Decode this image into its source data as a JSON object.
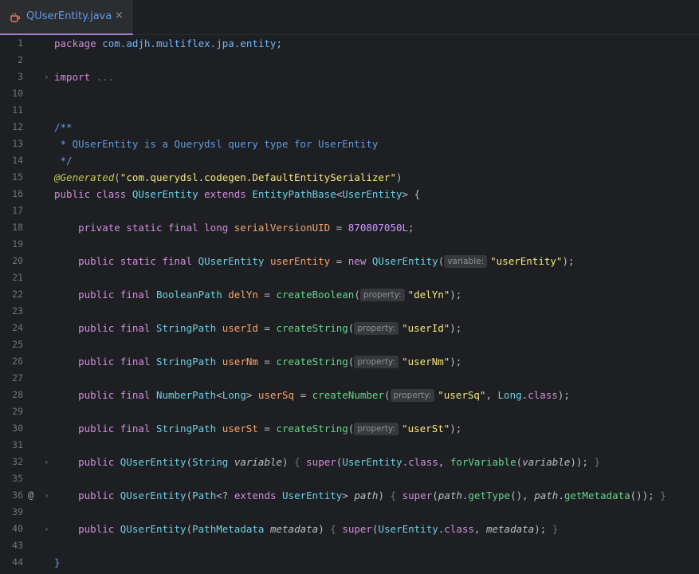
{
  "tab": {
    "filename": "QUserEntity.java",
    "close": "×"
  },
  "lines": [
    {
      "n": "1",
      "tokens": [
        [
          "kw",
          "package "
        ],
        [
          "pkg",
          "com.adjh.multiflex.jpa.entity"
        ],
        [
          "pun",
          ";"
        ]
      ]
    },
    {
      "n": "2",
      "tokens": []
    },
    {
      "n": "3",
      "fold": "›",
      "tokens": [
        [
          "kw",
          "import "
        ],
        [
          "dim",
          "..."
        ]
      ]
    },
    {
      "n": "10",
      "tokens": []
    },
    {
      "n": "11",
      "tokens": []
    },
    {
      "n": "12",
      "tokens": [
        [
          "cmt",
          "/**"
        ]
      ]
    },
    {
      "n": "13",
      "tokens": [
        [
          "cmt",
          " * QUserEntity is a Querydsl query type for UserEntity"
        ]
      ]
    },
    {
      "n": "14",
      "tokens": [
        [
          "cmt",
          " */"
        ]
      ]
    },
    {
      "n": "15",
      "tokens": [
        [
          "ann",
          "@Generated"
        ],
        [
          "pun",
          "("
        ],
        [
          "str",
          "\"com.querydsl.codegen.DefaultEntitySerializer\""
        ],
        [
          "pun",
          ")"
        ]
      ]
    },
    {
      "n": "16",
      "tokens": [
        [
          "kw",
          "public class "
        ],
        [
          "cls",
          "QUserEntity "
        ],
        [
          "kw",
          "extends "
        ],
        [
          "cls",
          "EntityPathBase"
        ],
        [
          "pun",
          "<"
        ],
        [
          "cls",
          "UserEntity"
        ],
        [
          "pun",
          "> {"
        ]
      ]
    },
    {
      "n": "17",
      "tokens": []
    },
    {
      "n": "18",
      "tokens": [
        [
          "pun",
          "    "
        ],
        [
          "kw",
          "private static final long "
        ],
        [
          "fld",
          "serialVersionUID"
        ],
        [
          "pun",
          " = "
        ],
        [
          "num",
          "870807050L"
        ],
        [
          "pun",
          ";"
        ]
      ]
    },
    {
      "n": "19",
      "tokens": []
    },
    {
      "n": "20",
      "tokens": [
        [
          "pun",
          "    "
        ],
        [
          "kw",
          "public static final "
        ],
        [
          "cls",
          "QUserEntity "
        ],
        [
          "fld",
          "userEntity"
        ],
        [
          "pun",
          " = "
        ],
        [
          "kw",
          "new "
        ],
        [
          "cls",
          "QUserEntity"
        ],
        [
          "pun",
          "("
        ],
        [
          "hint",
          "variable:"
        ],
        [
          "str",
          "\"userEntity\""
        ],
        [
          "pun",
          ");"
        ]
      ]
    },
    {
      "n": "21",
      "tokens": []
    },
    {
      "n": "22",
      "tokens": [
        [
          "pun",
          "    "
        ],
        [
          "kw",
          "public final "
        ],
        [
          "cls",
          "BooleanPath "
        ],
        [
          "fld",
          "delYn"
        ],
        [
          "pun",
          " = "
        ],
        [
          "fn",
          "createBoolean"
        ],
        [
          "pun",
          "("
        ],
        [
          "hint",
          "property:"
        ],
        [
          "str",
          "\"delYn\""
        ],
        [
          "pun",
          ");"
        ]
      ]
    },
    {
      "n": "23",
      "tokens": []
    },
    {
      "n": "24",
      "tokens": [
        [
          "pun",
          "    "
        ],
        [
          "kw",
          "public final "
        ],
        [
          "cls",
          "StringPath "
        ],
        [
          "fld",
          "userId"
        ],
        [
          "pun",
          " = "
        ],
        [
          "fn",
          "createString"
        ],
        [
          "pun",
          "("
        ],
        [
          "hint",
          "property:"
        ],
        [
          "str",
          "\"userId\""
        ],
        [
          "pun",
          ");"
        ]
      ]
    },
    {
      "n": "25",
      "tokens": []
    },
    {
      "n": "26",
      "tokens": [
        [
          "pun",
          "    "
        ],
        [
          "kw",
          "public final "
        ],
        [
          "cls",
          "StringPath "
        ],
        [
          "fld",
          "userNm"
        ],
        [
          "pun",
          " = "
        ],
        [
          "fn",
          "createString"
        ],
        [
          "pun",
          "("
        ],
        [
          "hint",
          "property:"
        ],
        [
          "str",
          "\"userNm\""
        ],
        [
          "pun",
          ");"
        ]
      ]
    },
    {
      "n": "27",
      "tokens": []
    },
    {
      "n": "28",
      "tokens": [
        [
          "pun",
          "    "
        ],
        [
          "kw",
          "public final "
        ],
        [
          "cls",
          "NumberPath"
        ],
        [
          "pun",
          "<"
        ],
        [
          "cls",
          "Long"
        ],
        [
          "pun",
          "> "
        ],
        [
          "fld",
          "userSq"
        ],
        [
          "pun",
          " = "
        ],
        [
          "fn",
          "createNumber"
        ],
        [
          "pun",
          "("
        ],
        [
          "hint",
          "property:"
        ],
        [
          "str",
          "\"userSq\""
        ],
        [
          "pun",
          ", "
        ],
        [
          "cls",
          "Long"
        ],
        [
          "pun",
          "."
        ],
        [
          "kw",
          "class"
        ],
        [
          "pun",
          ");"
        ]
      ]
    },
    {
      "n": "29",
      "tokens": []
    },
    {
      "n": "30",
      "tokens": [
        [
          "pun",
          "    "
        ],
        [
          "kw",
          "public final "
        ],
        [
          "cls",
          "StringPath "
        ],
        [
          "fld",
          "userSt"
        ],
        [
          "pun",
          " = "
        ],
        [
          "fn",
          "createString"
        ],
        [
          "pun",
          "("
        ],
        [
          "hint",
          "property:"
        ],
        [
          "str",
          "\"userSt\""
        ],
        [
          "pun",
          ");"
        ]
      ]
    },
    {
      "n": "31",
      "tokens": []
    },
    {
      "n": "32",
      "fold": "›",
      "tokens": [
        [
          "pun",
          "    "
        ],
        [
          "kw",
          "public "
        ],
        [
          "cls",
          "QUserEntity"
        ],
        [
          "pun",
          "("
        ],
        [
          "cls",
          "String "
        ],
        [
          "prm",
          "variable"
        ],
        [
          "pun",
          ") "
        ],
        [
          "dim",
          "{ "
        ],
        [
          "kw",
          "super"
        ],
        [
          "pun",
          "("
        ],
        [
          "cls",
          "UserEntity"
        ],
        [
          "pun",
          "."
        ],
        [
          "kw",
          "class"
        ],
        [
          "pun",
          ", "
        ],
        [
          "fn",
          "forVariable"
        ],
        [
          "pun",
          "("
        ],
        [
          "prm",
          "variable"
        ],
        [
          "pun",
          "));"
        ],
        [
          "dim",
          " }"
        ]
      ]
    },
    {
      "n": "35",
      "tokens": []
    },
    {
      "n": "36",
      "fold": "›",
      "at": "@",
      "tokens": [
        [
          "pun",
          "    "
        ],
        [
          "kw",
          "public "
        ],
        [
          "cls",
          "QUserEntity"
        ],
        [
          "pun",
          "("
        ],
        [
          "cls",
          "Path"
        ],
        [
          "pun",
          "<? "
        ],
        [
          "kw",
          "extends "
        ],
        [
          "cls",
          "UserEntity"
        ],
        [
          "pun",
          "> "
        ],
        [
          "prm",
          "path"
        ],
        [
          "pun",
          ") "
        ],
        [
          "dim",
          "{ "
        ],
        [
          "kw",
          "super"
        ],
        [
          "pun",
          "("
        ],
        [
          "prm",
          "path"
        ],
        [
          "pun",
          "."
        ],
        [
          "fn",
          "getType"
        ],
        [
          "pun",
          "(), "
        ],
        [
          "prm",
          "path"
        ],
        [
          "pun",
          "."
        ],
        [
          "fn",
          "getMetadata"
        ],
        [
          "pun",
          "());"
        ],
        [
          "dim",
          " }"
        ]
      ]
    },
    {
      "n": "39",
      "tokens": []
    },
    {
      "n": "40",
      "fold": "›",
      "tokens": [
        [
          "pun",
          "    "
        ],
        [
          "kw",
          "public "
        ],
        [
          "cls",
          "QUserEntity"
        ],
        [
          "pun",
          "("
        ],
        [
          "cls",
          "PathMetadata "
        ],
        [
          "prm",
          "metadata"
        ],
        [
          "pun",
          ") "
        ],
        [
          "dim",
          "{ "
        ],
        [
          "kw",
          "super"
        ],
        [
          "pun",
          "("
        ],
        [
          "cls",
          "UserEntity"
        ],
        [
          "pun",
          "."
        ],
        [
          "kw",
          "class"
        ],
        [
          "pun",
          ", "
        ],
        [
          "prm",
          "metadata"
        ],
        [
          "pun",
          ");"
        ],
        [
          "dim",
          " }"
        ]
      ]
    },
    {
      "n": "43",
      "tokens": []
    },
    {
      "n": "44",
      "tokens": [
        [
          "cmt",
          "}"
        ]
      ]
    }
  ]
}
